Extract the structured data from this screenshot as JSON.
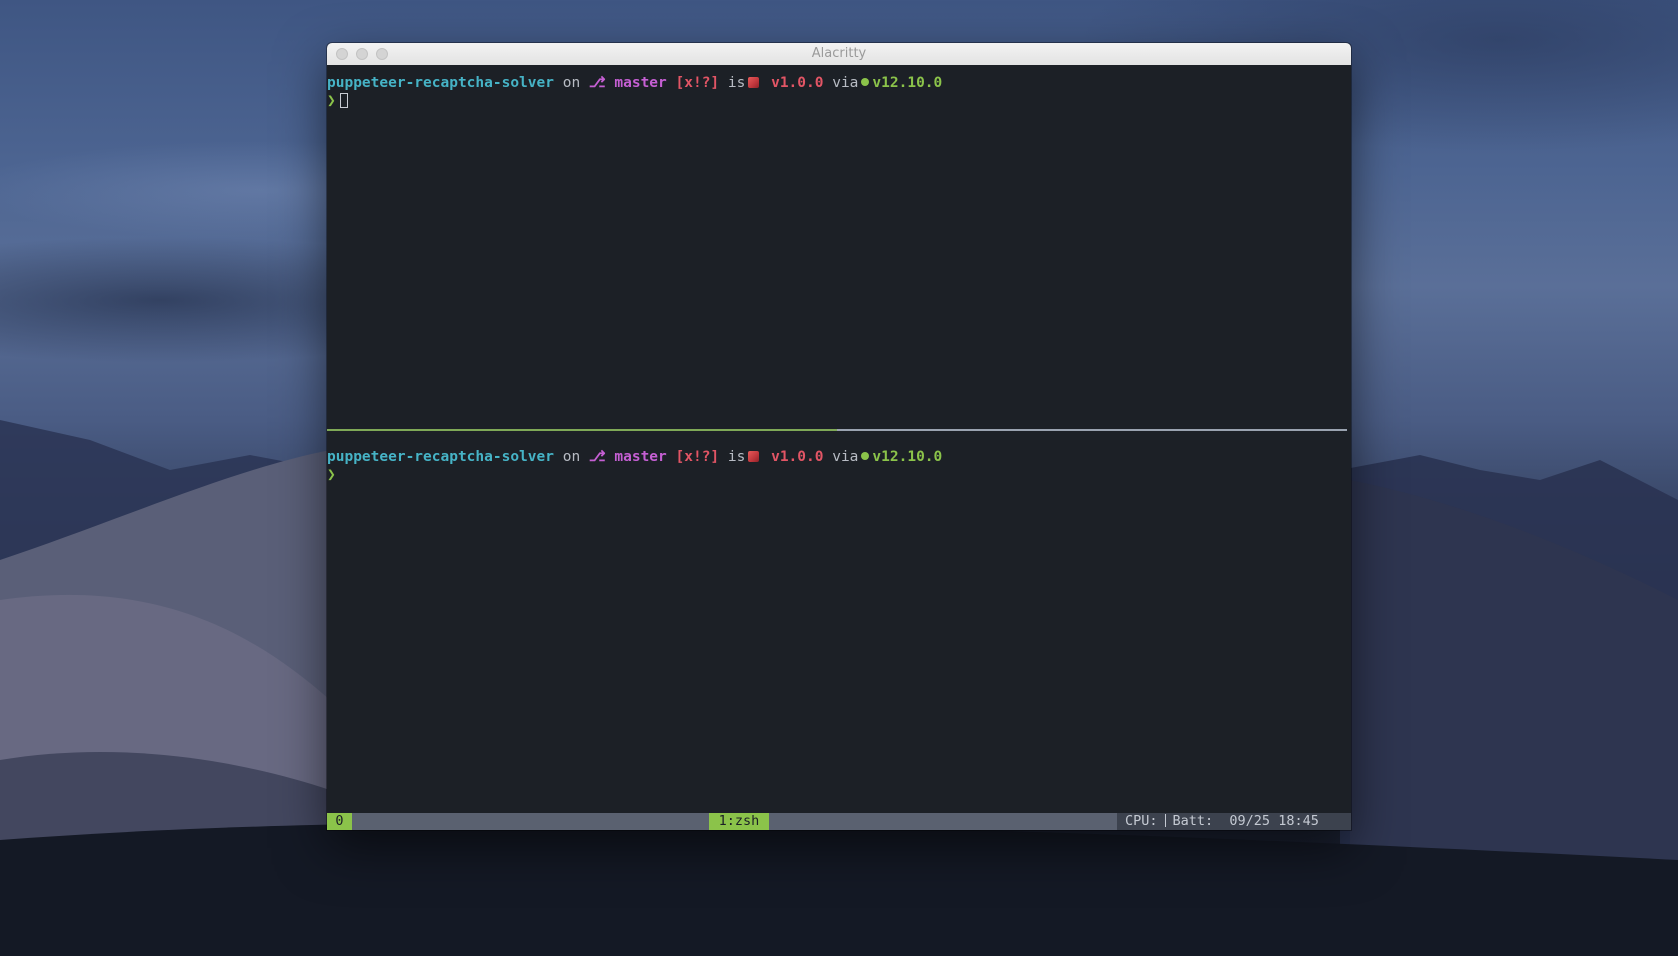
{
  "window": {
    "title": "Alacritty"
  },
  "prompt": {
    "directory": "puppeteer-recaptcha-solver",
    "on_word": "on",
    "branch_icon": "git-branch-icon",
    "branch": "master",
    "git_status": "[x!?]",
    "is_word": "is",
    "package_icon": "package-icon",
    "package_version": "v1.0.0",
    "via_word": "via",
    "node_icon": "node-dot-icon",
    "node_version": "v12.10.0",
    "symbol": "❯"
  },
  "statusbar": {
    "session": "0",
    "window": "1:zsh",
    "cpu_label": "CPU:",
    "batt_label": "Batt:",
    "datetime": "09/25 18:45"
  },
  "colors": {
    "directory": "#46b3c6",
    "branch": "#c55fd3",
    "version": "#e25565",
    "node": "#8bc34a",
    "terminal_bg": "#1c2026"
  }
}
